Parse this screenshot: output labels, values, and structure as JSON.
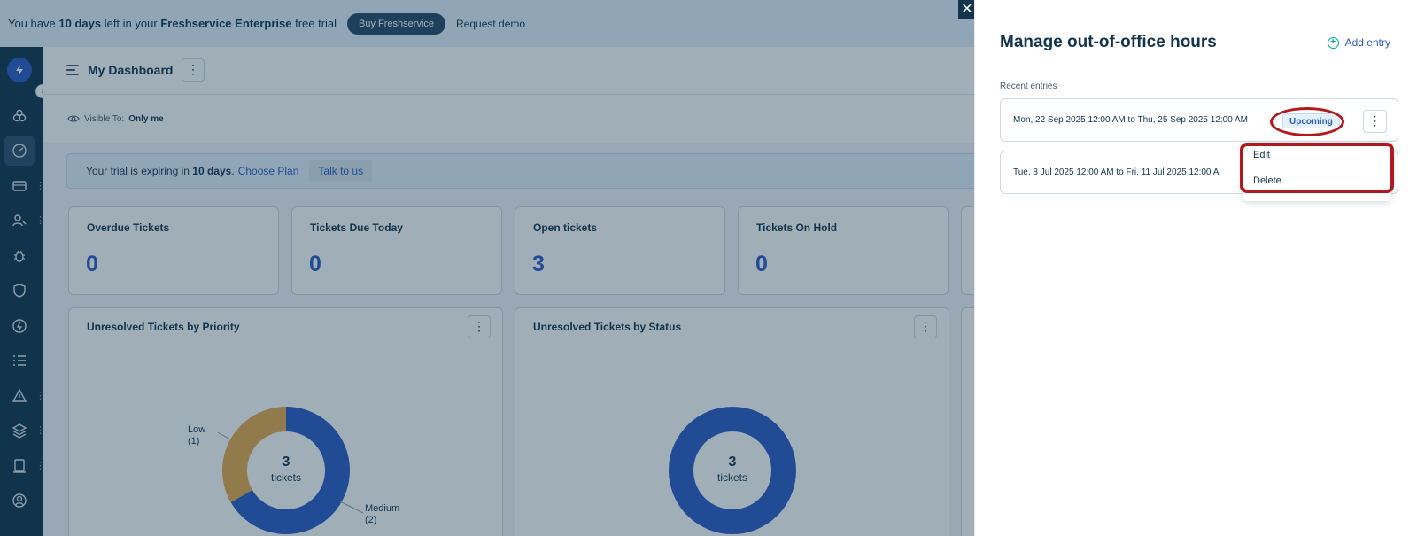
{
  "trial_banner": {
    "prefix": "You have",
    "days": "10 days",
    "mid": "left in your",
    "product": "Freshservice Enterprise",
    "suffix": "free trial",
    "buy_label": "Buy Freshservice",
    "demo_label": "Request demo"
  },
  "dashboard": {
    "title": "My Dashboard",
    "visible_label": "Visible To:",
    "visible_value": "Only me",
    "trial_strip": {
      "prefix": "Your trial is expiring in",
      "days": "10 days",
      "plan_link": "Choose Plan",
      "talk_label": "Talk to us"
    },
    "kpis": [
      {
        "label": "Overdue Tickets",
        "value": "0"
      },
      {
        "label": "Tickets Due Today",
        "value": "0"
      },
      {
        "label": "Open tickets",
        "value": "3"
      },
      {
        "label": "Tickets On Hold",
        "value": "0"
      }
    ],
    "widgets": [
      {
        "title": "Unresolved Tickets by Priority",
        "center_count": "3",
        "center_unit": "tickets",
        "legend": [
          {
            "name": "Low",
            "count": "(1)"
          },
          {
            "name": "Medium",
            "count": "(2)"
          }
        ]
      },
      {
        "title": "Unresolved Tickets by Status",
        "center_count": "3",
        "center_unit": "tickets"
      }
    ]
  },
  "chart_data": [
    {
      "type": "pie",
      "title": "Unresolved Tickets by Priority",
      "categories": [
        "Low",
        "Medium"
      ],
      "values": [
        1,
        2
      ],
      "colors": [
        "#e7a94b",
        "#2c5cc5"
      ]
    },
    {
      "type": "pie",
      "title": "Unresolved Tickets by Status",
      "categories": [
        ""
      ],
      "values": [
        3
      ],
      "colors": [
        "#2c5cc5"
      ]
    }
  ],
  "panel": {
    "title": "Manage out-of-office hours",
    "add_entry_label": "Add entry",
    "recent_label": "Recent entries",
    "entries": [
      {
        "range": "Mon, 22 Sep 2025 12:00 AM to Thu, 25 Sep 2025 12:00 AM",
        "badge": "Upcoming"
      },
      {
        "range": "Tue, 8 Jul 2025 12:00 AM to Fri, 11 Jul 2025 12:00 A",
        "badge": ""
      }
    ],
    "menu_options": [
      "Edit",
      "Delete"
    ]
  },
  "sidebar_icons": [
    "logo-icon",
    "apps-icon",
    "dashboard-icon",
    "tickets-icon",
    "users-icon",
    "bug-icon",
    "shield-icon",
    "changes-icon",
    "tasks-icon",
    "alert-icon",
    "layers-icon",
    "reports-icon",
    "admin-icon"
  ],
  "colors": {
    "brand_blue": "#2c5cc5",
    "navy": "#12344d",
    "annotation_red": "#b2191d",
    "success_green": "#00a886"
  }
}
